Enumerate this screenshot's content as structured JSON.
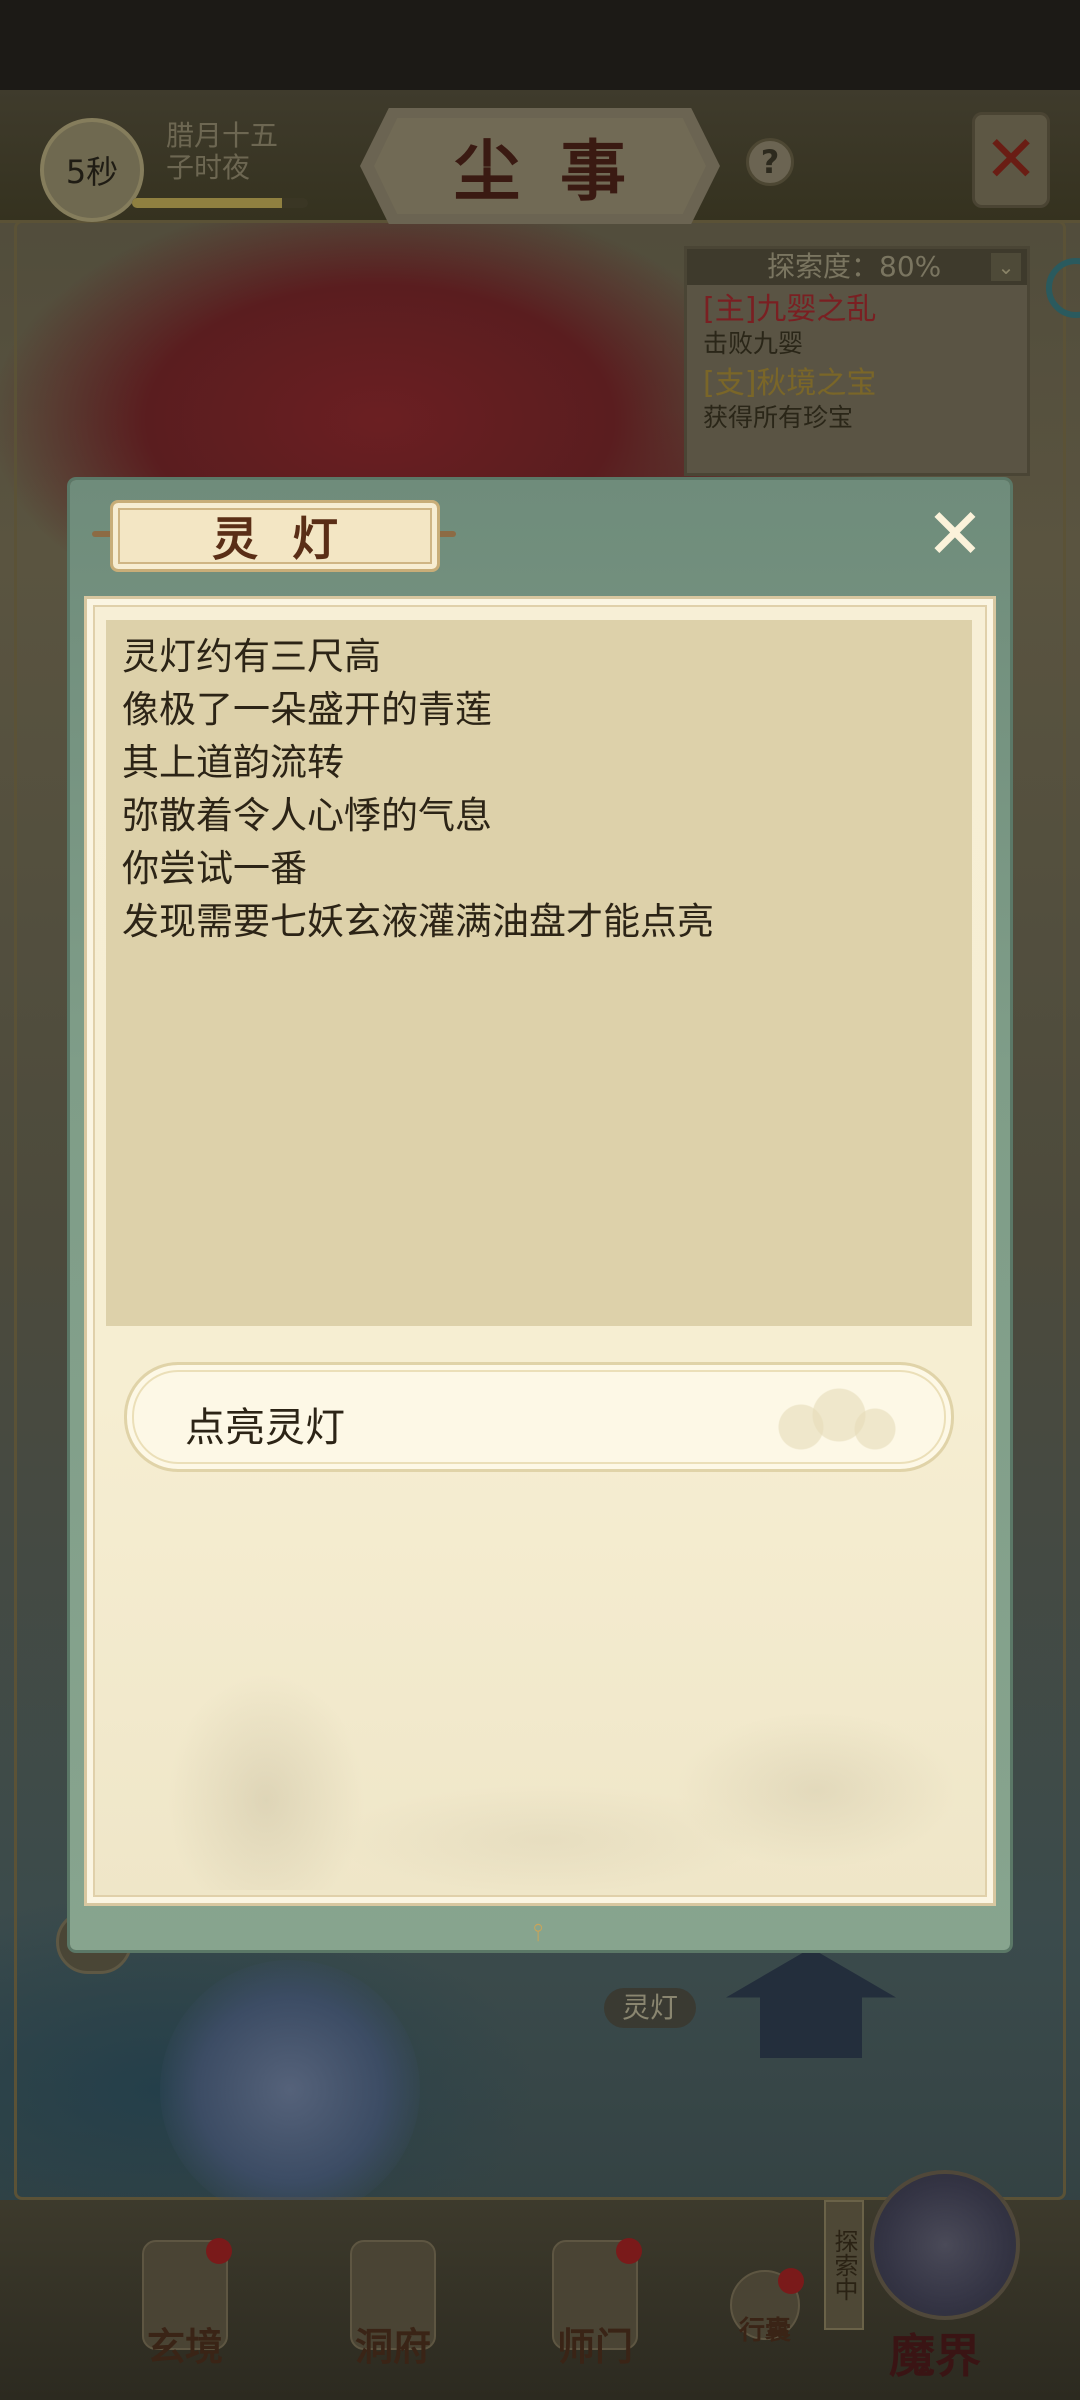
{
  "header": {
    "timer": "5秒",
    "date_line1": "腊月十五",
    "date_line2": "子时夜",
    "progress": 0.85,
    "title": "尘事",
    "help_glyph": "?",
    "close_glyph": "✕"
  },
  "quest_panel": {
    "explore_progress": "探索度：80%",
    "chevron": "⌄",
    "quests": [
      {
        "title": "[主]九婴之乱",
        "desc": "击败九婴",
        "kind": "main"
      },
      {
        "title": "[支]秋境之宝",
        "desc": "获得所有珍宝",
        "kind": "side"
      }
    ]
  },
  "dialog": {
    "title": "灵灯",
    "close_glyph": "✕",
    "lines": [
      "灵灯约有三尺高",
      "像极了一朵盛开的青莲",
      "其上道韵流转",
      "弥散着令人心悸的气息",
      "你尝试一番",
      "发现需要七妖玄液灌满油盘才能点亮"
    ],
    "choice": "点亮灵灯"
  },
  "map": {
    "node_label": "灵灯",
    "chat_glyph": "···"
  },
  "bottom_nav": {
    "items": [
      {
        "label": "玄境",
        "badge": true
      },
      {
        "label": "洞府",
        "badge": false
      },
      {
        "label": "师门",
        "badge": true
      },
      {
        "label": "行囊",
        "badge": true
      },
      {
        "label": "魔界",
        "badge": false
      }
    ],
    "exploring": "探索中"
  },
  "colors": {
    "dialog_green": "#7f9d88",
    "parchment": "#f7efd6",
    "text_box": "#ddd1aa",
    "title_text": "#5a2e16"
  }
}
